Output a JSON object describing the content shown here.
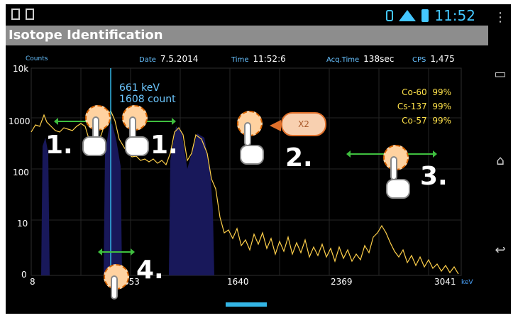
{
  "status_bar": {
    "left_icons": [
      "download-icon",
      "gallery-icon"
    ],
    "time": "11:52",
    "right_icons": [
      "bluetooth-icon",
      "wifi-icon",
      "signal-icon",
      "battery-icon"
    ]
  },
  "title_bar": {
    "title": "Isotope Identification"
  },
  "header": {
    "date_label": "Date",
    "date_value": "7.5.2014",
    "time_label": "Time",
    "time_value": "11:52:6",
    "acq_label": "Acq.Time",
    "acq_value": "138sec",
    "cps_label": "CPS",
    "cps_value": "1,475"
  },
  "chart": {
    "counts_label": "Counts",
    "y_ticks": [
      "10k",
      "1000",
      "100",
      "10",
      "0"
    ],
    "x_ticks": [
      "8",
      "853",
      "1640",
      "2369",
      "3041"
    ],
    "x_unit": "keV",
    "peak_annotation": {
      "energy": "661 keV",
      "count": "1608 count"
    },
    "identified": [
      {
        "isotope": "Co-60",
        "confidence": "99%"
      },
      {
        "isotope": "Cs-137",
        "confidence": "99%"
      },
      {
        "isotope": "Co-57",
        "confidence": "99%"
      }
    ]
  },
  "gestures": {
    "labels": [
      "1.",
      "1.",
      "2.",
      "3.",
      "4."
    ],
    "double_tap_hint": "X2"
  },
  "colors": {
    "accent": "#33b5e5",
    "spectrum": "#ffd04a",
    "peak_fill": "#18185a",
    "title_bar_bg": "#8d8d8d",
    "identified_text": "#ffe24a"
  },
  "nav_bar": {
    "menu_icon": "overflow-menu-icon",
    "recent_icon": "recent-apps-icon",
    "home_icon": "home-icon",
    "back_icon": "back-icon"
  }
}
